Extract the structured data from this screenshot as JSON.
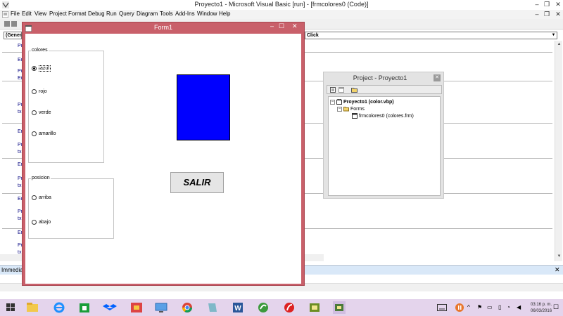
{
  "ide": {
    "title": "Proyecto1 - Microsoft Visual Basic [run] - [frmcolores0 (Code)]",
    "menu": [
      "File",
      "Edit",
      "View",
      "Project",
      "Format",
      "Debug",
      "Run",
      "Query",
      "Diagram",
      "Tools",
      "Add-Ins",
      "Window",
      "Help"
    ],
    "object_combo": "(General)",
    "proc_combo": "Click",
    "code_fragments": [
      "Pr",
      "En",
      "Pr",
      "En",
      "Pr",
      "tx",
      "En",
      "Pr",
      "tx",
      "En",
      "Pr",
      "tx",
      "En",
      "Pr",
      "tx",
      "En",
      "Pr",
      "tx"
    ],
    "immediate_label": "Immediate"
  },
  "form": {
    "title": "Form1",
    "frame_colores": {
      "caption": "colores",
      "options": [
        {
          "label": "azul",
          "checked": true,
          "focused": true
        },
        {
          "label": "rojo",
          "checked": false,
          "focused": false
        },
        {
          "label": "verde",
          "checked": false,
          "focused": false
        },
        {
          "label": "amarillo",
          "checked": false,
          "focused": false
        }
      ]
    },
    "frame_posicion": {
      "caption": "posicion",
      "options": [
        {
          "label": "arriba",
          "checked": false,
          "focused": false
        },
        {
          "label": "abajo",
          "checked": false,
          "focused": false
        }
      ]
    },
    "color_box": "#0000ff",
    "salir_label": "SALIR"
  },
  "project": {
    "title": "Project - Proyecto1",
    "tree": {
      "root": "Proyecto1 (color.vbp)",
      "folder": "Forms",
      "item": "frmcolores0 (colores.frm)"
    }
  },
  "taskbar": {
    "time": "03:16 p. m.",
    "date": "06/03/2016",
    "apps": [
      "file-explorer",
      "internet-explorer",
      "store",
      "dropbox",
      "photos",
      "remote-desktop",
      "chrome",
      "files",
      "word",
      "dreamweaver",
      "flash",
      "vb6",
      "vb6-active"
    ]
  }
}
